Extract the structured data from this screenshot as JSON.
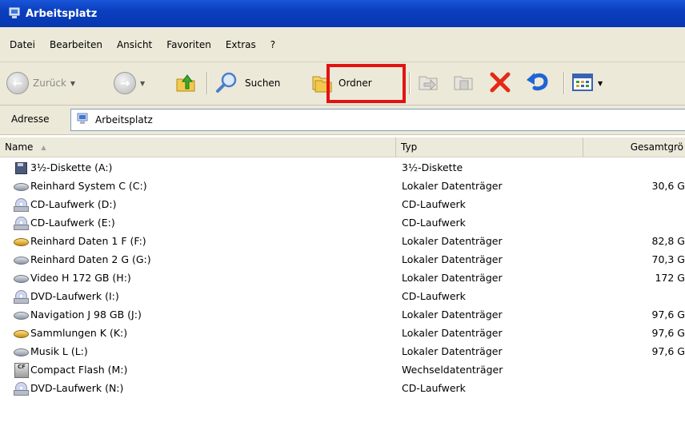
{
  "window": {
    "title": "Arbeitsplatz"
  },
  "menu": {
    "items": [
      "Datei",
      "Bearbeiten",
      "Ansicht",
      "Favoriten",
      "Extras",
      "?"
    ]
  },
  "toolbar": {
    "back_label": "Zurück",
    "search_label": "Suchen",
    "folders_label": "Ordner"
  },
  "address": {
    "label": "Adresse",
    "value": "Arbeitsplatz"
  },
  "columns": {
    "name": "Name",
    "type": "Typ",
    "size": "Gesamtgrö"
  },
  "rows": [
    {
      "name": "3½-Diskette (A:)",
      "type": "3½-Diskette",
      "size": "",
      "icon": "floppy"
    },
    {
      "name": "Reinhard System C (C:)",
      "type": "Lokaler Datenträger",
      "size": "30,6 G",
      "icon": "hdd"
    },
    {
      "name": "CD-Laufwerk (D:)",
      "type": "CD-Laufwerk",
      "size": "",
      "icon": "cd"
    },
    {
      "name": "CD-Laufwerk (E:)",
      "type": "CD-Laufwerk",
      "size": "",
      "icon": "cd"
    },
    {
      "name": "Reinhard Daten 1 F (F:)",
      "type": "Lokaler Datenträger",
      "size": "82,8 G",
      "icon": "share"
    },
    {
      "name": "Reinhard Daten 2 G (G:)",
      "type": "Lokaler Datenträger",
      "size": "70,3 G",
      "icon": "hdd"
    },
    {
      "name": "Video H 172 GB (H:)",
      "type": "Lokaler Datenträger",
      "size": "172 G",
      "icon": "hdd"
    },
    {
      "name": "DVD-Laufwerk (I:)",
      "type": "CD-Laufwerk",
      "size": "",
      "icon": "cd"
    },
    {
      "name": "Navigation J 98 GB (J:)",
      "type": "Lokaler Datenträger",
      "size": "97,6 G",
      "icon": "hdd"
    },
    {
      "name": "Sammlungen  K (K:)",
      "type": "Lokaler Datenträger",
      "size": "97,6 G",
      "icon": "share"
    },
    {
      "name": "Musik L (L:)",
      "type": "Lokaler Datenträger",
      "size": "97,6 G",
      "icon": "hdd"
    },
    {
      "name": "Compact Flash (M:)",
      "type": "Wechseldatenträger",
      "size": "",
      "icon": "cf"
    },
    {
      "name": "DVD-Laufwerk (N:)",
      "type": "CD-Laufwerk",
      "size": "",
      "icon": "cd"
    }
  ]
}
